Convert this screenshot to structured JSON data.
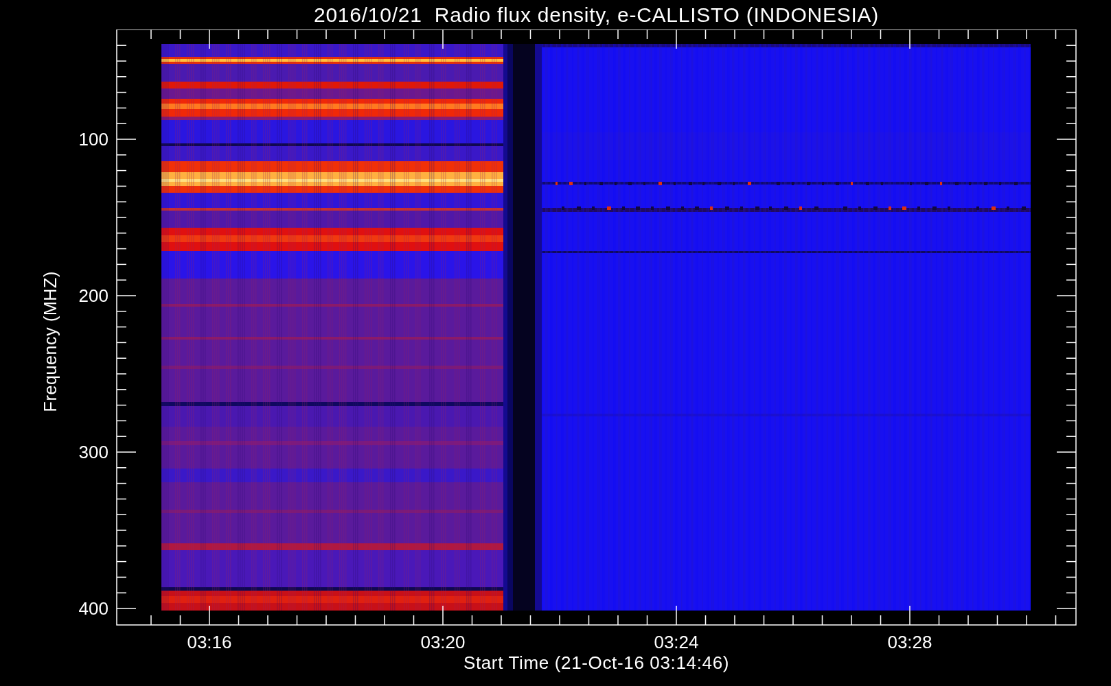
{
  "title": "2016/10/21  Radio flux density, e-CALLISTO (INDONESIA)",
  "y_axis": {
    "label": "Frequency (MHZ)",
    "ticks": [
      "100",
      "200",
      "300",
      "400"
    ]
  },
  "x_axis": {
    "label": "Start Time (21-Oct-16 03:14:46)",
    "ticks": [
      "03:16",
      "03:20",
      "03:24",
      "03:28"
    ]
  }
}
